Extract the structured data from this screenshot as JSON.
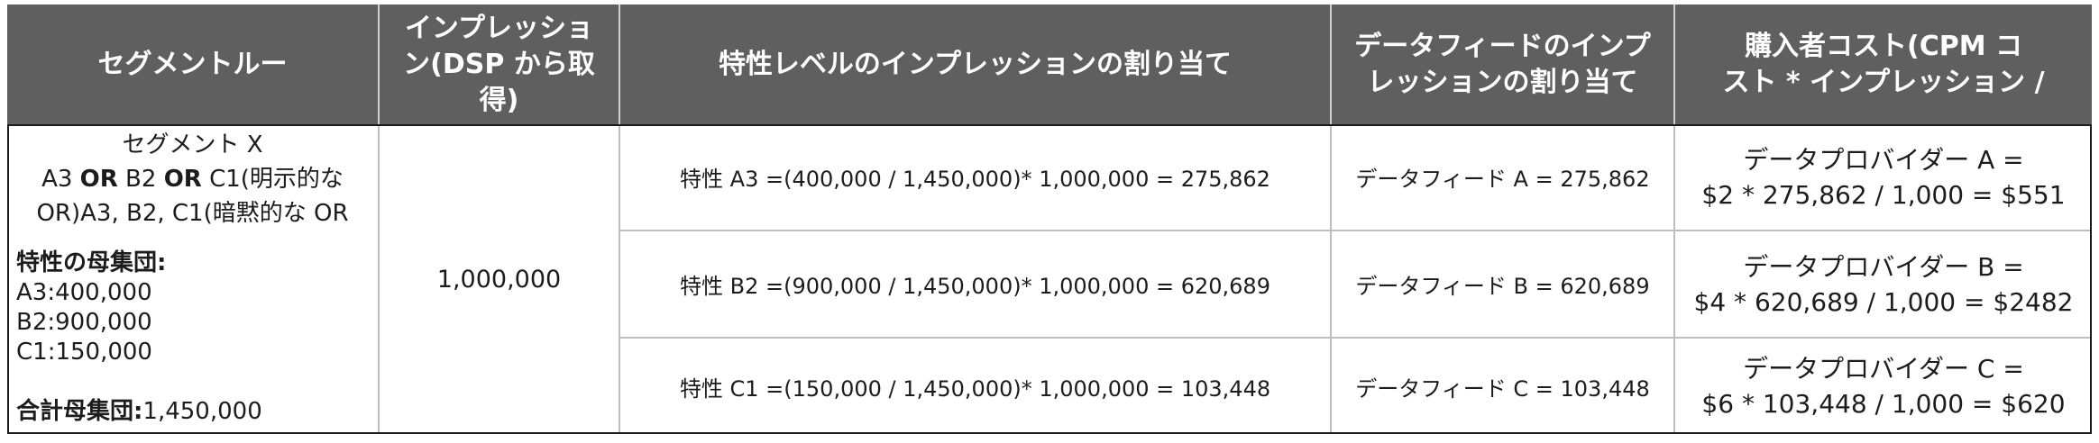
{
  "table": {
    "headers": [
      {
        "lines": [
          "セグメントルー"
        ]
      },
      {
        "lines": [
          "インプレッショ",
          "ン(DSP から取",
          "得)"
        ]
      },
      {
        "lines": [
          "特性レベルのインプレッションの割り当て"
        ]
      },
      {
        "lines": [
          "データフィードのインプ",
          "レッションの割り当て"
        ]
      },
      {
        "lines": [
          "購入者コスト(CPM コ",
          "スト * インプレッション /"
        ]
      }
    ],
    "segment": {
      "title": "セグメント X",
      "rule_explicit_parts": [
        "A3 ",
        "OR",
        " B2 ",
        "OR",
        " C1(明示的な"
      ],
      "rule_implicit": "OR)A3, B2, C1(暗黙的な OR",
      "population_heading": "特性の母集団:",
      "populations": [
        "A3:400,000",
        "B2:900,000",
        "C1:150,000"
      ],
      "total_label": "合計母集団:",
      "total_value": "1,450,000"
    },
    "dsp_impressions": "1,000,000",
    "rows": [
      {
        "trait_allocation": "特性 A3 =(400,000 / 1,450,000)* 1,000,000 = 275,862",
        "feed_allocation": "データフィード A = 275,862",
        "buyer_cost": [
          "データプロバイダー A =",
          "$2 * 275,862 / 1,000 = $551"
        ]
      },
      {
        "trait_allocation": "特性 B2 =(900,000 / 1,450,000)* 1,000,000 = 620,689",
        "feed_allocation": "データフィード B = 620,689",
        "buyer_cost": [
          "データプロバイダー B =",
          "$4 * 620,689 / 1,000 = $2482"
        ]
      },
      {
        "trait_allocation": "特性 C1 =(150,000 / 1,450,000)* 1,000,000 = 103,448",
        "feed_allocation": "データフィード C = 103,448",
        "buyer_cost": [
          "データプロバイダー C =",
          "$6 * 103,448 / 1,000 = $620"
        ]
      }
    ]
  },
  "colors": {
    "header_background": "#5f5f5f",
    "header_text": "#ffffff",
    "body_text": "#1c1c1c",
    "outer_border": "#1c1c1c",
    "inner_border": "#bdbdbd"
  }
}
